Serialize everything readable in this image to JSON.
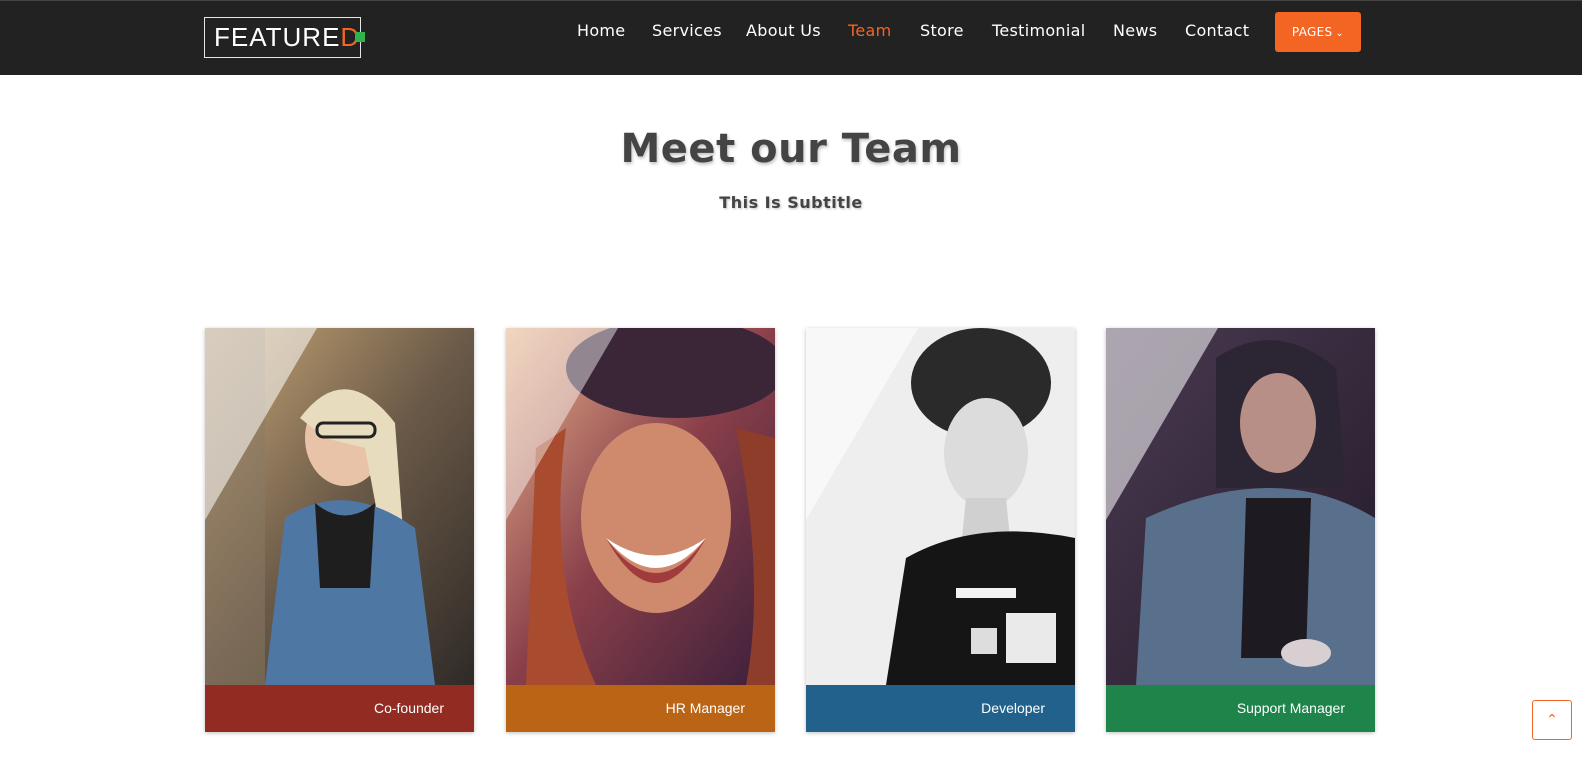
{
  "header": {
    "logo": {
      "text_main": "FEATURE",
      "text_accent": "D"
    },
    "nav": [
      {
        "label": "Home",
        "active": false
      },
      {
        "label": "Services",
        "active": false
      },
      {
        "label": "About Us",
        "active": false
      },
      {
        "label": "Team",
        "active": true
      },
      {
        "label": "Store",
        "active": false
      },
      {
        "label": "Testimonial",
        "active": false
      },
      {
        "label": "News",
        "active": false
      },
      {
        "label": "Contact",
        "active": false
      }
    ],
    "pages_button": {
      "label": "PAGES",
      "icon": "chevron-down-icon"
    }
  },
  "section": {
    "title": "Meet our Team",
    "subtitle": "This Is Subtitle"
  },
  "team": [
    {
      "role": "Co-founder",
      "color": "#922b21"
    },
    {
      "role": "HR Manager",
      "color": "#ba6416"
    },
    {
      "role": "Developer",
      "color": "#21618c"
    },
    {
      "role": "Support Manager",
      "color": "#1e8449"
    }
  ],
  "scroll_top": {
    "icon": "chevron-up-icon"
  },
  "colors": {
    "accent": "#f26522",
    "nav_bg": "#222222",
    "title": "#444444"
  }
}
